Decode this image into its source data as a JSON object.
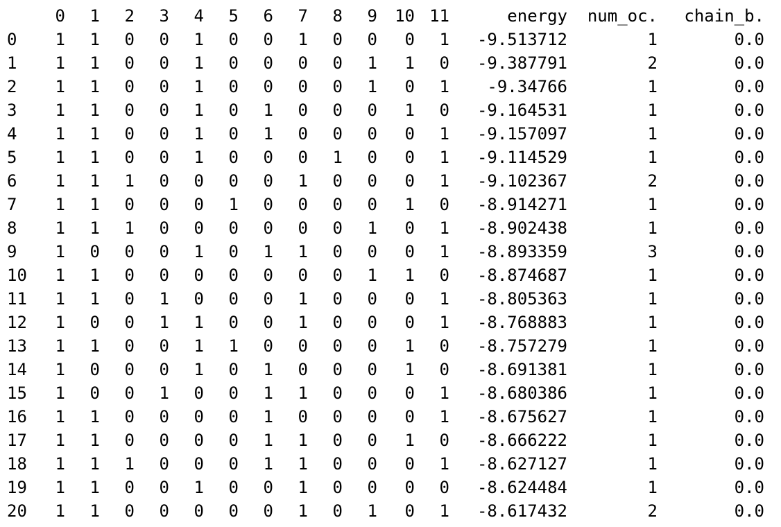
{
  "columns": [
    "0",
    "1",
    "2",
    "3",
    "4",
    "5",
    "6",
    "7",
    "8",
    "9",
    "10",
    "11",
    "energy",
    "num_oc.",
    "chain_b."
  ],
  "rows": [
    {
      "index": "0",
      "values": [
        "1",
        "1",
        "0",
        "0",
        "1",
        "0",
        "0",
        "1",
        "0",
        "0",
        "0",
        "1",
        "-9.513712",
        "1",
        "0.0"
      ]
    },
    {
      "index": "1",
      "values": [
        "1",
        "1",
        "0",
        "0",
        "1",
        "0",
        "0",
        "0",
        "0",
        "1",
        "1",
        "0",
        "-9.387791",
        "2",
        "0.0"
      ]
    },
    {
      "index": "2",
      "values": [
        "1",
        "1",
        "0",
        "0",
        "1",
        "0",
        "0",
        "0",
        "0",
        "1",
        "0",
        "1",
        "-9.34766",
        "1",
        "0.0"
      ]
    },
    {
      "index": "3",
      "values": [
        "1",
        "1",
        "0",
        "0",
        "1",
        "0",
        "1",
        "0",
        "0",
        "0",
        "1",
        "0",
        "-9.164531",
        "1",
        "0.0"
      ]
    },
    {
      "index": "4",
      "values": [
        "1",
        "1",
        "0",
        "0",
        "1",
        "0",
        "1",
        "0",
        "0",
        "0",
        "0",
        "1",
        "-9.157097",
        "1",
        "0.0"
      ]
    },
    {
      "index": "5",
      "values": [
        "1",
        "1",
        "0",
        "0",
        "1",
        "0",
        "0",
        "0",
        "1",
        "0",
        "0",
        "1",
        "-9.114529",
        "1",
        "0.0"
      ]
    },
    {
      "index": "6",
      "values": [
        "1",
        "1",
        "1",
        "0",
        "0",
        "0",
        "0",
        "1",
        "0",
        "0",
        "0",
        "1",
        "-9.102367",
        "2",
        "0.0"
      ]
    },
    {
      "index": "7",
      "values": [
        "1",
        "1",
        "0",
        "0",
        "0",
        "1",
        "0",
        "0",
        "0",
        "0",
        "1",
        "0",
        "-8.914271",
        "1",
        "0.0"
      ]
    },
    {
      "index": "8",
      "values": [
        "1",
        "1",
        "1",
        "0",
        "0",
        "0",
        "0",
        "0",
        "0",
        "1",
        "0",
        "1",
        "-8.902438",
        "1",
        "0.0"
      ]
    },
    {
      "index": "9",
      "values": [
        "1",
        "0",
        "0",
        "0",
        "1",
        "0",
        "1",
        "1",
        "0",
        "0",
        "0",
        "1",
        "-8.893359",
        "3",
        "0.0"
      ]
    },
    {
      "index": "10",
      "values": [
        "1",
        "1",
        "0",
        "0",
        "0",
        "0",
        "0",
        "0",
        "0",
        "1",
        "1",
        "0",
        "-8.874687",
        "1",
        "0.0"
      ]
    },
    {
      "index": "11",
      "values": [
        "1",
        "1",
        "0",
        "1",
        "0",
        "0",
        "0",
        "1",
        "0",
        "0",
        "0",
        "1",
        "-8.805363",
        "1",
        "0.0"
      ]
    },
    {
      "index": "12",
      "values": [
        "1",
        "0",
        "0",
        "1",
        "1",
        "0",
        "0",
        "1",
        "0",
        "0",
        "0",
        "1",
        "-8.768883",
        "1",
        "0.0"
      ]
    },
    {
      "index": "13",
      "values": [
        "1",
        "1",
        "0",
        "0",
        "1",
        "1",
        "0",
        "0",
        "0",
        "0",
        "1",
        "0",
        "-8.757279",
        "1",
        "0.0"
      ]
    },
    {
      "index": "14",
      "values": [
        "1",
        "0",
        "0",
        "0",
        "1",
        "0",
        "1",
        "0",
        "0",
        "0",
        "1",
        "0",
        "-8.691381",
        "1",
        "0.0"
      ]
    },
    {
      "index": "15",
      "values": [
        "1",
        "0",
        "0",
        "1",
        "0",
        "0",
        "1",
        "1",
        "0",
        "0",
        "0",
        "1",
        "-8.680386",
        "1",
        "0.0"
      ]
    },
    {
      "index": "16",
      "values": [
        "1",
        "1",
        "0",
        "0",
        "0",
        "0",
        "1",
        "0",
        "0",
        "0",
        "0",
        "1",
        "-8.675627",
        "1",
        "0.0"
      ]
    },
    {
      "index": "17",
      "values": [
        "1",
        "1",
        "0",
        "0",
        "0",
        "0",
        "1",
        "1",
        "0",
        "0",
        "1",
        "0",
        "-8.666222",
        "1",
        "0.0"
      ]
    },
    {
      "index": "18",
      "values": [
        "1",
        "1",
        "1",
        "0",
        "0",
        "0",
        "1",
        "1",
        "0",
        "0",
        "0",
        "1",
        "-8.627127",
        "1",
        "0.0"
      ]
    },
    {
      "index": "19",
      "values": [
        "1",
        "1",
        "0",
        "0",
        "1",
        "0",
        "0",
        "1",
        "0",
        "0",
        "0",
        "0",
        "-8.624484",
        "1",
        "0.0"
      ]
    },
    {
      "index": "20",
      "values": [
        "1",
        "1",
        "0",
        "0",
        "0",
        "0",
        "0",
        "1",
        "0",
        "1",
        "0",
        "1",
        "-8.617432",
        "2",
        "0.0"
      ]
    }
  ]
}
